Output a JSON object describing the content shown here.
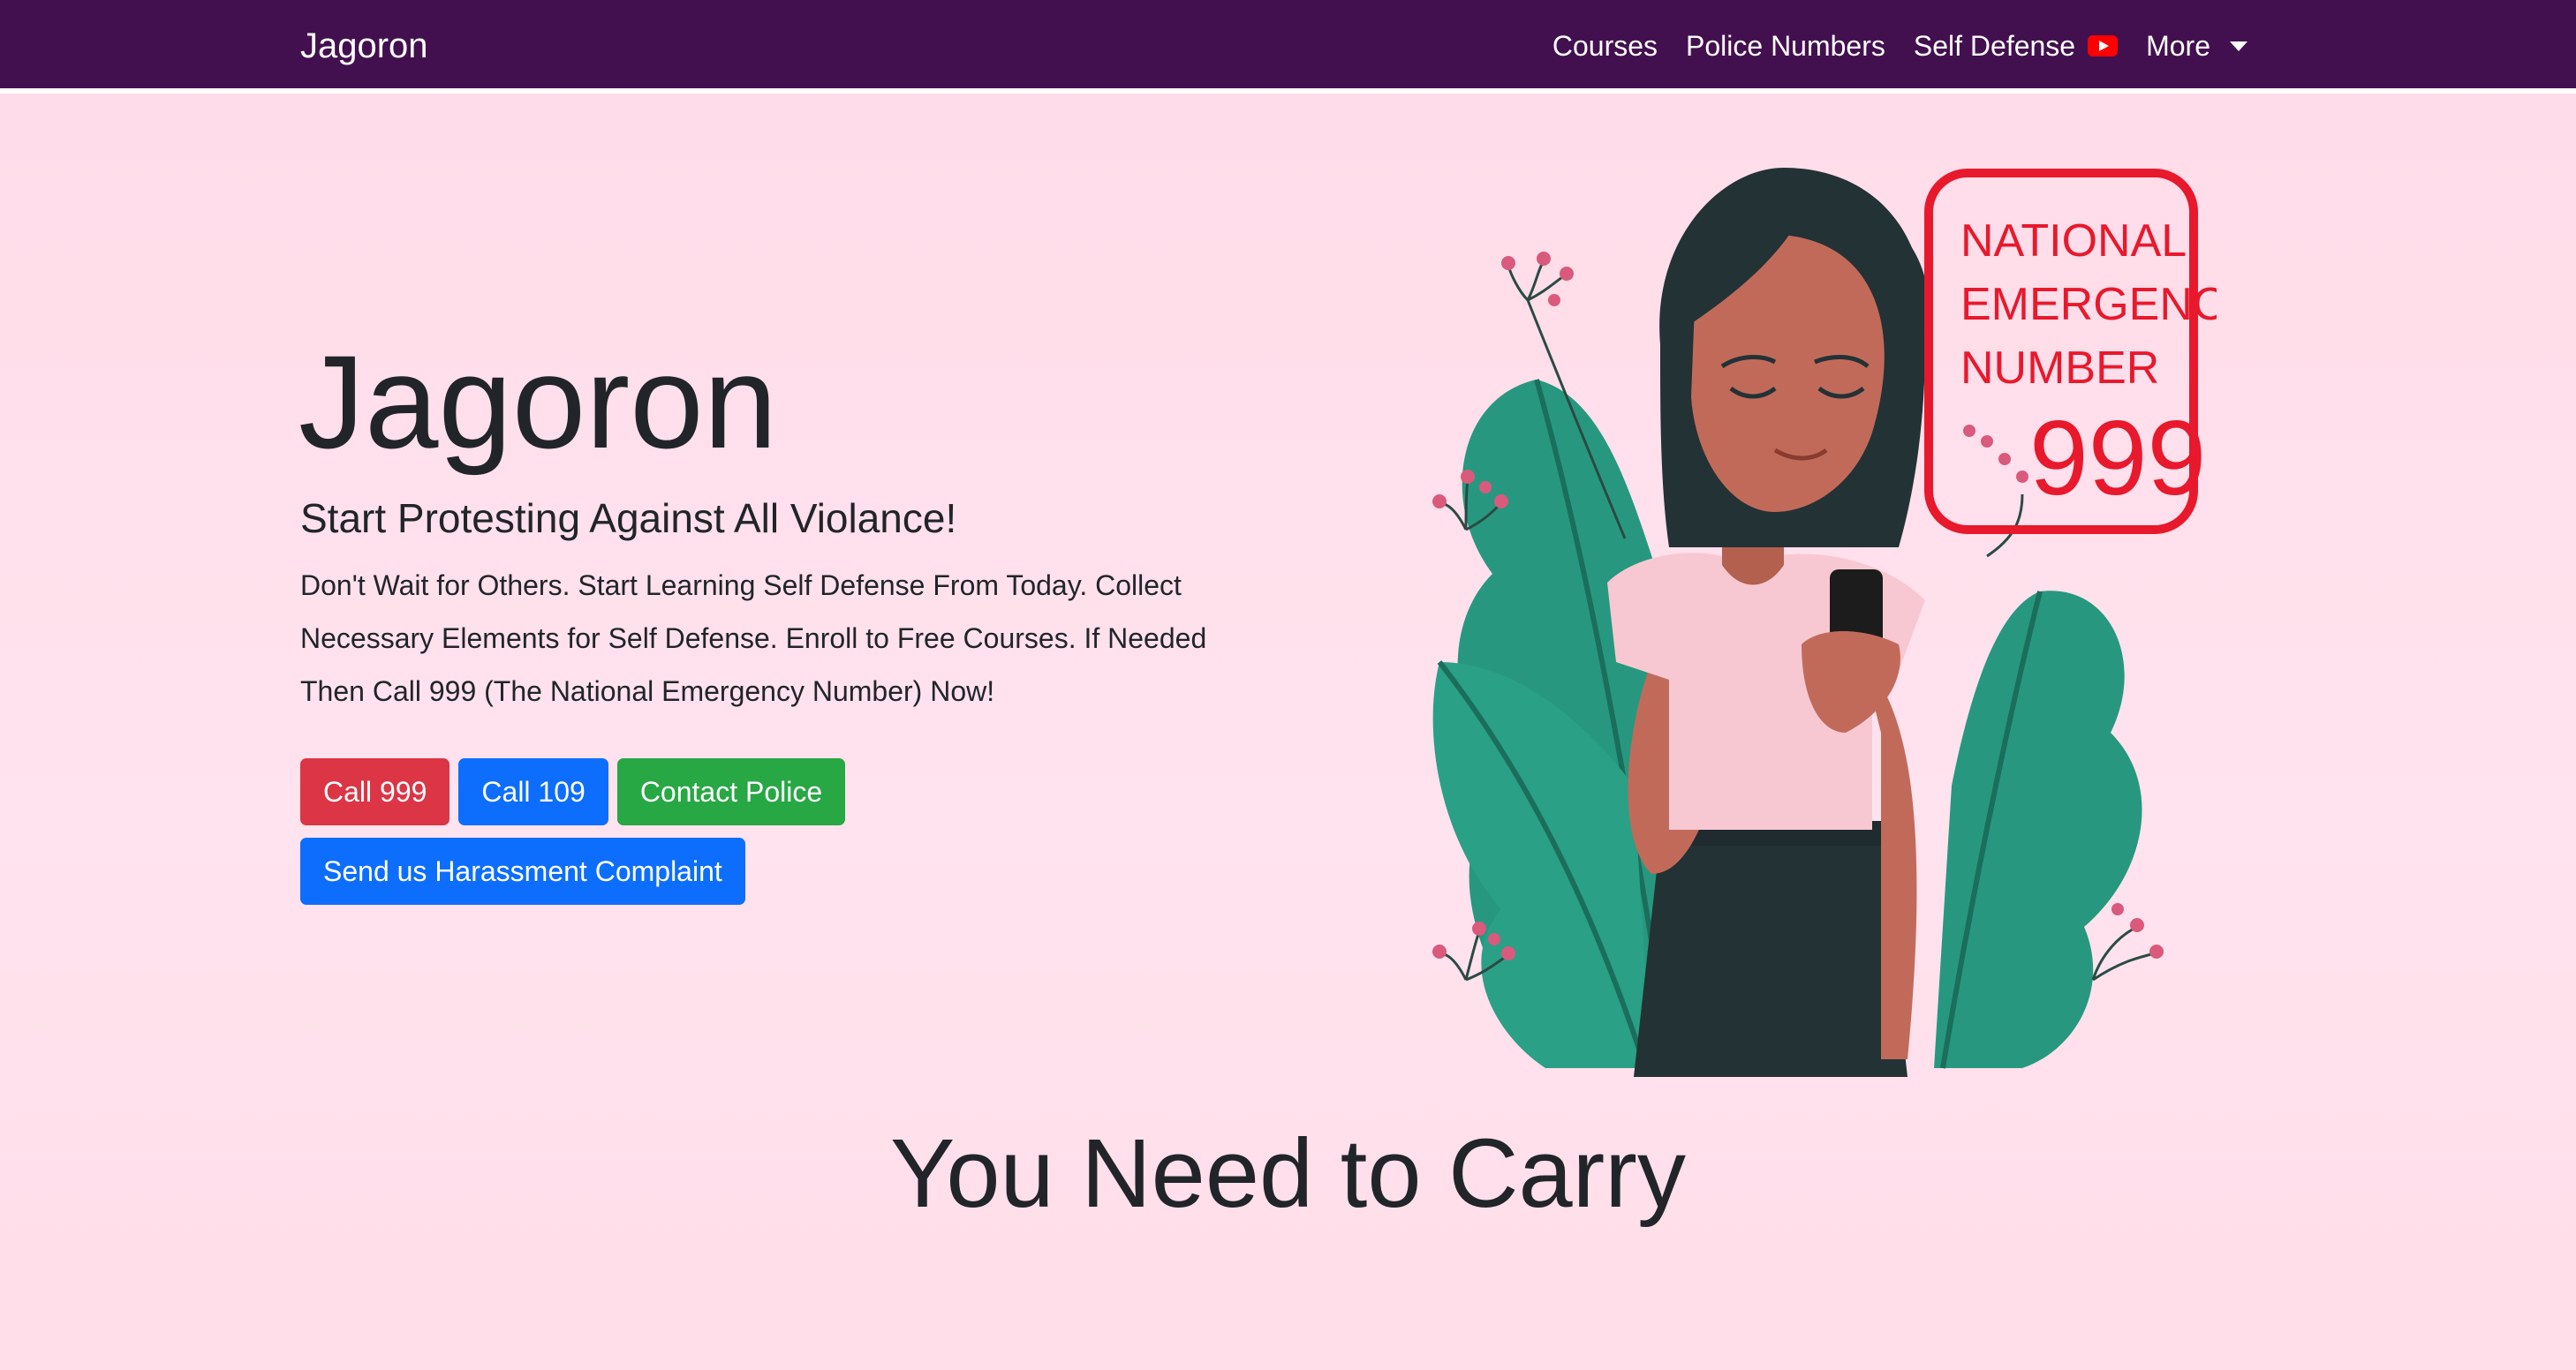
{
  "navbar": {
    "brand": "Jagoron",
    "items": [
      {
        "label": "Courses"
      },
      {
        "label": "Police Numbers"
      },
      {
        "label": "Self Defense"
      },
      {
        "label": "More"
      }
    ]
  },
  "hero": {
    "title": "Jagoron",
    "subtitle": "Start Protesting Against All Violance!",
    "text": "Don't Wait for Others. Start Learning Self Defense From Today. Collect Necessary Elements for Self Defense. Enroll to Free Courses. If Needed Then Call 999 (The National Emergency Number) Now!",
    "buttons": {
      "call_999": "Call 999",
      "call_109": "Call 109",
      "contact_police": "Contact Police",
      "complaint": "Send us Harassment Complaint"
    }
  },
  "illustration": {
    "sign_line1": "NATIONAL",
    "sign_line2": "EMERGENCY",
    "sign_line3": "NUMBER",
    "sign_number": "999"
  },
  "section": {
    "title": "You Need to Carry"
  },
  "colors": {
    "navbar": "#43104f",
    "danger": "#dc3545",
    "primary": "#0d6efd",
    "success": "#28a745",
    "sign": "#e8192c"
  }
}
